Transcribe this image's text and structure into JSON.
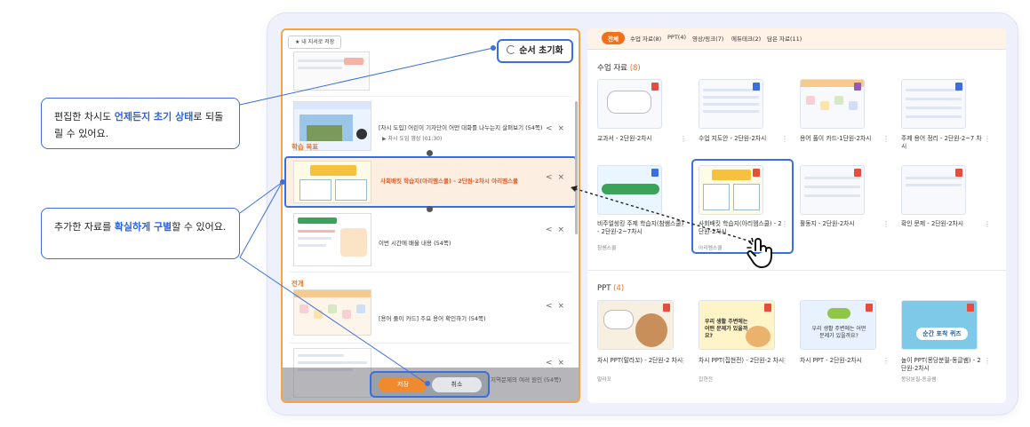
{
  "callouts": {
    "reset": {
      "pre": "편집한 차시도 ",
      "em": "언제든지 초기 상태",
      "post": "로 되돌릴 수 있어요."
    },
    "distinguish": {
      "pre": "추가한 자료를 ",
      "em": "확실하게 구별",
      "post": "할 수 있어요."
    }
  },
  "editor": {
    "save_textbook": "내 지서로 저장",
    "reset_label": "순서 초기화",
    "sections": {
      "goal": "학습 목표",
      "develop": "전개"
    },
    "rows": [
      {
        "title": "[차시 도입] 어린이 기자단이 어떤 대화를 나누는지 살펴보기 (54쪽)",
        "sub": "▶ 차시 도입 영상 (01:30)"
      },
      {
        "title": "사회배킷 학습지(아리멤스쿨) - 2단원-2차시 아리멤스쿨",
        "sub": ""
      },
      {
        "title": "이번 시간에 배울 내용 (54쪽)",
        "sub": ""
      },
      {
        "title": "[용어 풀이 카드] 주요 용어 확인하기 (54쪽)",
        "sub": ""
      },
      {
        "title": "지역문제의 여러 원인 (54쪽)",
        "sub": ""
      }
    ],
    "save_label": "저장",
    "cancel_label": "취소"
  },
  "library": {
    "tabs": [
      "전체",
      "수업 자료(8)",
      "PPT(4)",
      "영상/링크(7)",
      "에듀테크(2)",
      "담은 자료(11)"
    ],
    "materials_title": "수업 자료",
    "materials_count": "(8)",
    "materials": [
      {
        "label": "교과서 - 2단원-2차시",
        "sub": ""
      },
      {
        "label": "수업 지도안 - 2단원-2차시",
        "sub": ""
      },
      {
        "label": "용어 풀이 카드-1단원-2차시",
        "sub": ""
      },
      {
        "label": "주제 용어 정리 - 2단원-2~7 차시",
        "sub": ""
      },
      {
        "label": "비주얼씽킹 주제 학습지(참쌤스쿨) - 2단원-2~7차시",
        "sub": "참쌤스쿨"
      },
      {
        "label": "사회배킷 학습지(아리멤스쿨) - 2단원-2차시",
        "sub": "아리멤스쿨"
      },
      {
        "label": "활동지 - 2단원-2차시",
        "sub": ""
      },
      {
        "label": "확인 문제 - 2단원-2차시",
        "sub": ""
      }
    ],
    "ppt_title": "PPT",
    "ppt_count": "(4)",
    "ppts": [
      {
        "label": "차시 PPT(말라꼬) - 2단원-2 차시",
        "sub": "말라꼬"
      },
      {
        "label": "차시 PPT(집현전) - 2단원-2 차시",
        "sub": "집현전"
      },
      {
        "label": "차시 PPT - 2단원-2차시",
        "sub": ""
      },
      {
        "label": "놀이 PPT(몽당분필-동글쌤) - 2단원-2차시",
        "sub": "몽당분필-동글쌤"
      }
    ],
    "ppt_headlines": [
      "우리 생활 주변에는 어떤 문제가 있을까요?",
      "우리 생활 주변에는 어떤 문제가 있을까요?",
      "순간 포착 퀴즈"
    ]
  },
  "colors": {
    "accent": "#f0701c",
    "highlight": "#3b6fe0",
    "selected_bg": "#fdeee2"
  }
}
